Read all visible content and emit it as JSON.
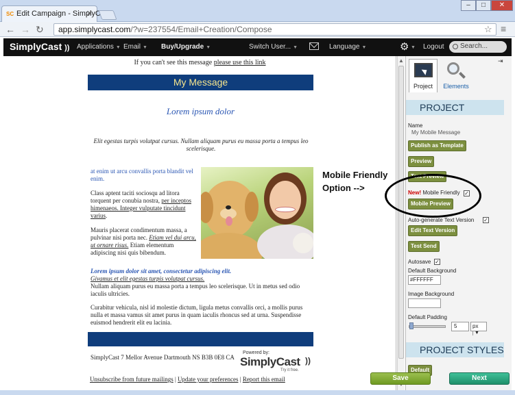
{
  "browser": {
    "tab_title": "Edit Campaign - SimplyC",
    "tab_favicon": "SC",
    "url_domain": "app.simplycast.com",
    "url_path": "/?w=237554/Email+Creation/Compose"
  },
  "appnav": {
    "logo": "SimplyCast",
    "items": [
      "Applications",
      "Email",
      "Buy/Upgrade",
      "Switch User...",
      "Language",
      "Logout"
    ],
    "search_placeholder": "Search..."
  },
  "email": {
    "view_text": "If you can't see this message ",
    "view_link": "please use this link",
    "header": "My Message",
    "heading": "Lorem ipsum dolor",
    "intro": "Elit egestas turpis volutpat cursus. Nullam aliquam purus eu massa porta a tempus leo scelerisque.",
    "col_blue": "at enim ut arcu convallis porta blandit vel enim.",
    "col_p1_a": "Class aptent taciti sociosqu ad litora torquent per conubia nostra, ",
    "col_p1_link": "per inceptos himenaeos. Integer vulputate tincidunt varius",
    "col_p1_b": ".",
    "col_p2_a": "Mauris placerat condimentum massa, a pulvinar nisi porta nec. ",
    "col_p2_link": "Etiam vel dui arcu, ut ornare risus.",
    "col_p2_b": " Etiam elementum adipiscing nisi quis bibendum.",
    "p3_bold": "Lorem ipsum dolor sit amet, consectetur adipiscing elit.",
    "p3_under": "Givamus et elit egestas turpis volutpat cursus.",
    "p3_rest": "Nullam aliquam purus eu massa porta a tempus leo scelerisque. Ut in metus sed odio iaculis ultricies.",
    "p4": "Curabitur vehicula, nisl id molestie dictum, ligula metus convallis orci, a mollis purus nulla et massa vamus sit amet purus in quam iaculis rhoncus sed at urna. Suspendisse euismod hendrerit elit eu lacinia.",
    "address": "SimplyCast 7 Mellor Avenue Dartmouth NS B3B 0E8 CA",
    "powered_by": "Powered by:",
    "powered_logo": "SimplyCast",
    "tagline": "Try it free.",
    "footer_links": [
      "Unsubscribe from future mailings",
      "Update your preferences",
      "Report this email"
    ]
  },
  "annotation": {
    "line1": "Mobile Friendly",
    "line2": "Option -->"
  },
  "panel": {
    "tab_project": "Project",
    "tab_elements": "Elements",
    "section_project": "PROJECT",
    "name_label": "Name",
    "name_value": "My Mobile Message",
    "btn_publish": "Publish as Template",
    "btn_preview": "Preview",
    "btn_text_preview": "Text Preview",
    "new_label": "New!",
    "mobile_friendly": "Mobile Friendly",
    "btn_mobile_preview": "Mobile Preview",
    "auto_text": "Auto-generate Text Version",
    "btn_edit_text": "Edit Text Version",
    "btn_test_send": "Test Send",
    "autosave": "Autosave",
    "default_bg_label": "Default Background",
    "default_bg_value": "#FFFFFF",
    "image_bg_label": "Image Background",
    "image_bg_value": "",
    "padding_label": "Default Padding",
    "padding_value": "5",
    "padding_unit": "px",
    "section_styles": "PROJECT STYLES",
    "btn_default": "Default"
  },
  "footer": {
    "save": "Save",
    "next": "Next"
  }
}
